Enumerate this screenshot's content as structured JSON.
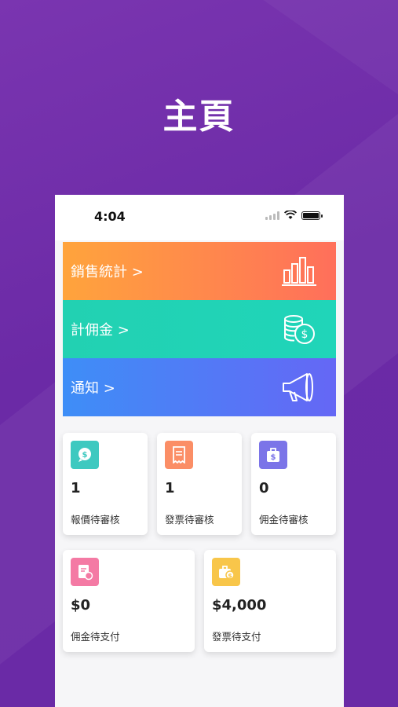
{
  "page_title": "主頁",
  "status_bar": {
    "time": "4:04"
  },
  "banners": [
    {
      "label": "銷售統計 >",
      "icon": "bar-chart-icon"
    },
    {
      "label": "計佣金 >",
      "icon": "coins-icon"
    },
    {
      "label": "通知 >",
      "icon": "megaphone-icon"
    }
  ],
  "stats_row1": [
    {
      "value": "1",
      "label": "報價待審核",
      "icon": "dollar-chat-icon",
      "color": "#3ec9c0"
    },
    {
      "value": "1",
      "label": "發票待審核",
      "icon": "receipt-icon",
      "color": "#fb8e66"
    },
    {
      "value": "0",
      "label": "佣金待審核",
      "icon": "money-bag-icon",
      "color": "#7b74e8"
    }
  ],
  "stats_row2": [
    {
      "value": "$0",
      "label": "佣金待支付",
      "icon": "invoice-refresh-icon",
      "color": "#f47aa4"
    },
    {
      "value": "$4,000",
      "label": "發票待支付",
      "icon": "briefcase-dollar-icon",
      "color": "#f8c64a"
    }
  ]
}
